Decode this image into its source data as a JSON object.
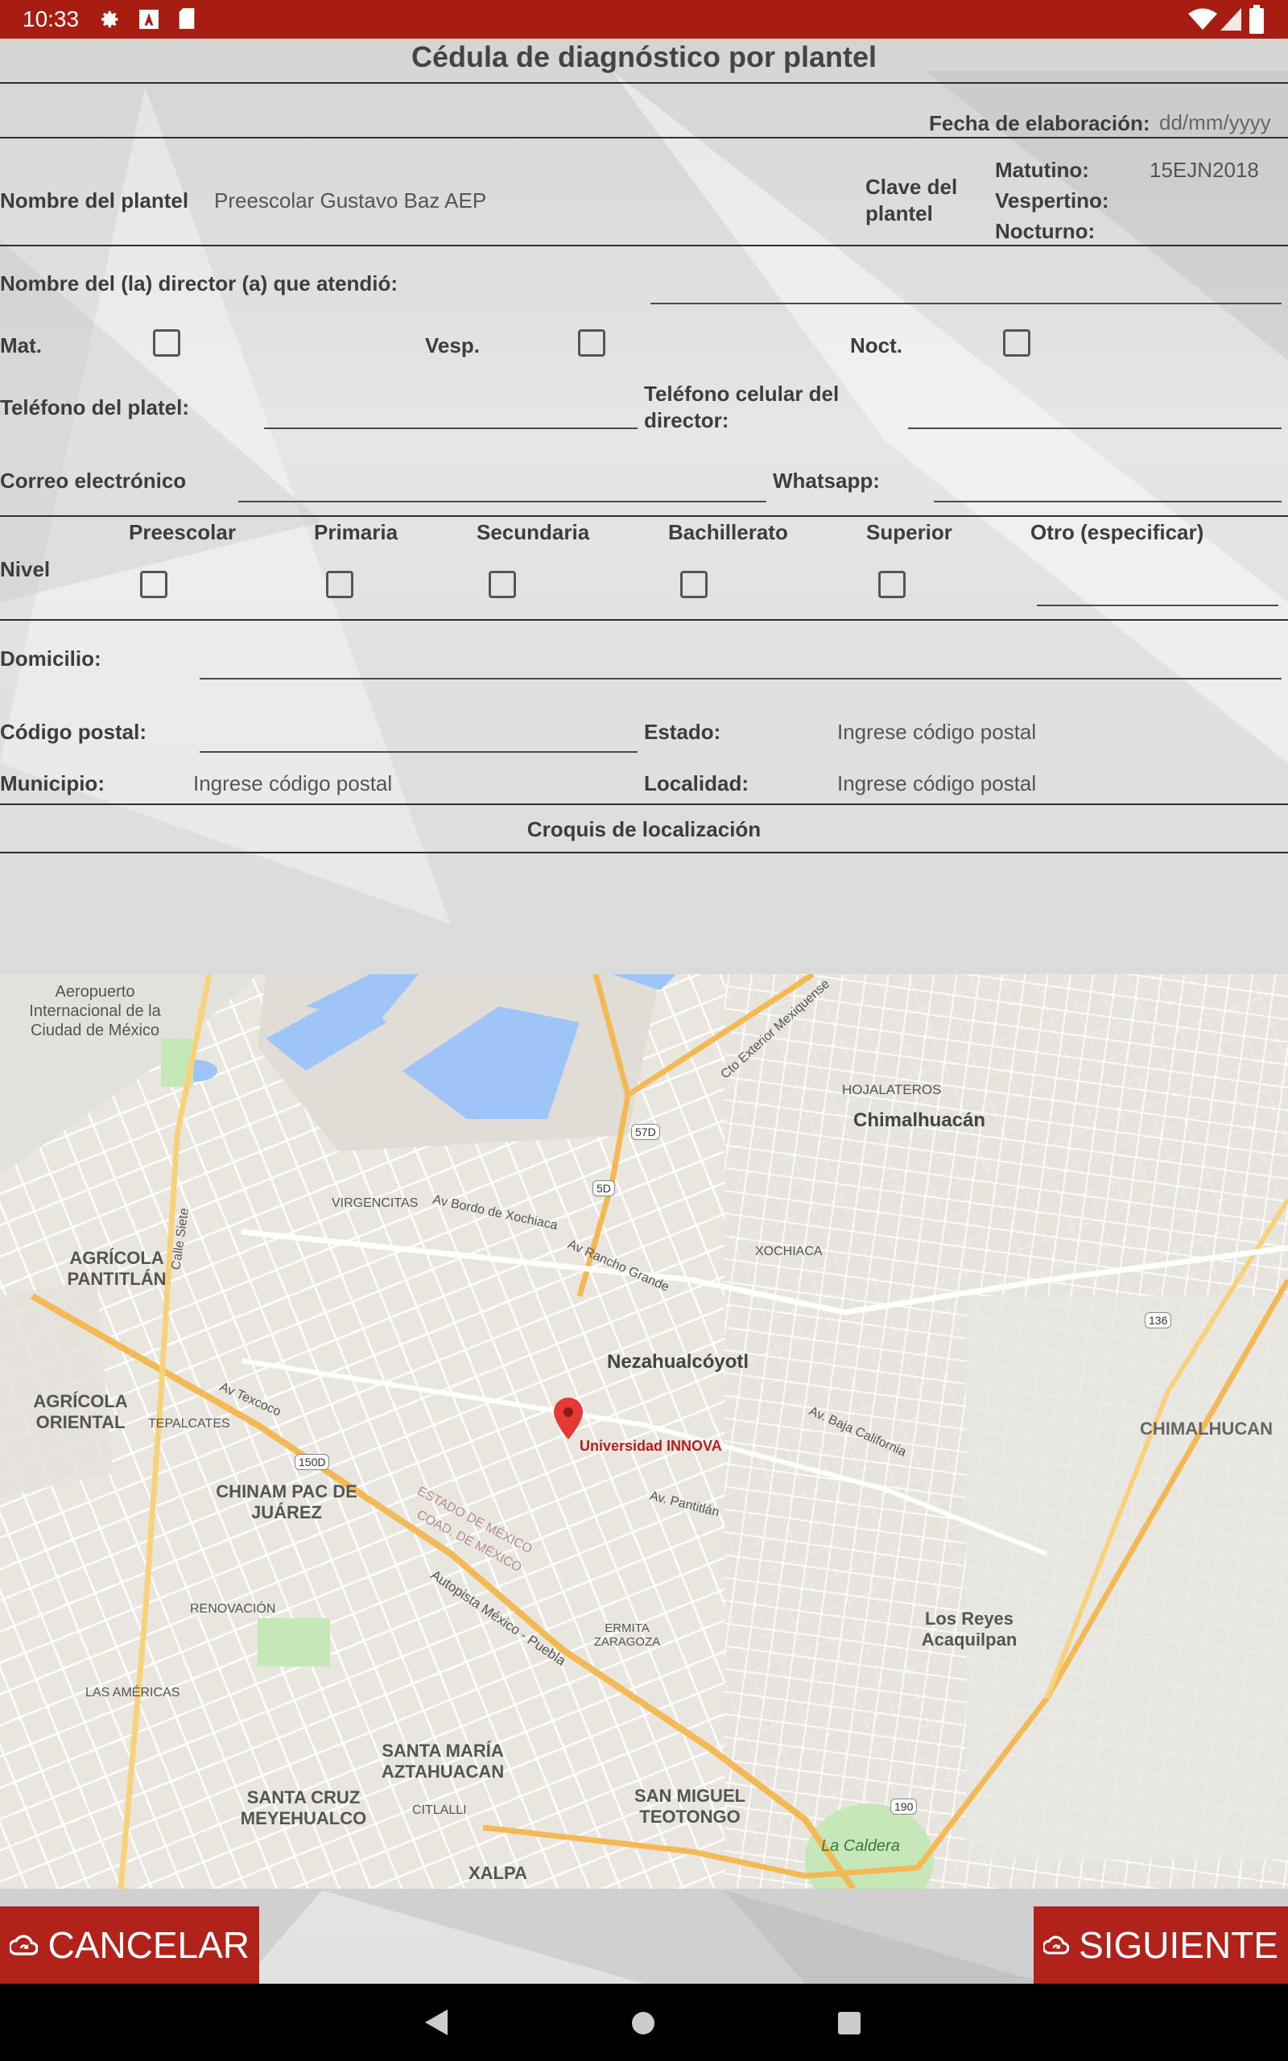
{
  "status_bar": {
    "time": "10:33",
    "icons": [
      "gear-icon",
      "a-box-icon",
      "sd-card-icon",
      "wifi-icon",
      "signal-icon",
      "battery-icon"
    ]
  },
  "form": {
    "title": "Cédula de diagnóstico por plantel",
    "fecha_label": "Fecha de elaboración:",
    "fecha_placeholder": "dd/mm/yyyy",
    "nombre_plantel_label": "Nombre del plantel",
    "nombre_plantel_value": "Preescolar Gustavo Baz AEP",
    "clave_label": "Clave del plantel",
    "matutino_label": "Matutino:",
    "vespertino_label": "Vespertino:",
    "nocturno_label": "Nocturno:",
    "clave_value": "15EJN2018",
    "director_label": "Nombre del (la) director (a) que atendió:",
    "mat_label": "Mat.",
    "vesp_label": "Vesp.",
    "noct_label": "Noct.",
    "telefono_label": "Teléfono del platel:",
    "celular_label": "Teléfono celular del director:",
    "correo_label": "Correo electrónico",
    "whatsapp_label": "Whatsapp:",
    "nivel_label": "Nivel",
    "niveles": [
      "Preescolar",
      "Primaria",
      "Secundaria",
      "Bachillerato",
      "Superior",
      "Otro (especificar)"
    ],
    "domicilio_label": "Domicilio:",
    "cp_label": "Código postal:",
    "estado_label": "Estado:",
    "estado_value": "Ingrese código postal",
    "municipio_label": "Municipio:",
    "municipio_value": "Ingrese código postal",
    "localidad_label": "Localidad:",
    "localidad_value": "Ingrese código postal",
    "croquis_label": "Croquis de localización"
  },
  "map": {
    "marker_label": "Universidad INNOVA",
    "places": [
      "Aeropuerto Internacional de la Ciudad de México",
      "Chimalhuacán",
      "HOJALATEROS",
      "Nezahualcóyotl",
      "AGRÍCOLA PANTITLÁN",
      "AGRÍCOLA ORIENTAL",
      "TEPALCATES",
      "CHINAM PAC DE JUÁREZ",
      "RENOVACIÓN",
      "LAS AMÉRICAS",
      "SANTA MARÍA AZTAHUACAN",
      "SANTA CRUZ MEYEHUALCO",
      "CITLALLI",
      "SAN MIGUEL TEOTONGO",
      "ERMITA ZARAGOZA",
      "Los Reyes Acaquilpan",
      "La Caldera",
      "XALPA",
      "VIRGENCITAS",
      "XOCHIACA",
      "CHIMALHUCAN",
      "ESTADO DE MÉXICO",
      "COAD. DE MÉXICO"
    ],
    "roads": [
      "Autopista México - Puebla",
      "Av Bordo de Xochiaca",
      "Av. Pantitlán",
      "Av Rancho Grande",
      "Cto Exterior Mexiquense",
      "Calle Siete",
      "Av Texcoco",
      "Av. Baja California"
    ],
    "shields": [
      "150D",
      "190",
      "136",
      "57D",
      "5D"
    ]
  },
  "buttons": {
    "cancel": "CANCELAR",
    "next": "SIGUIENTE"
  },
  "nav": {
    "back": "back-icon",
    "home": "home-icon",
    "recents": "recents-icon"
  },
  "colors": {
    "accent": "#a81d12",
    "button": "#b1221a"
  }
}
